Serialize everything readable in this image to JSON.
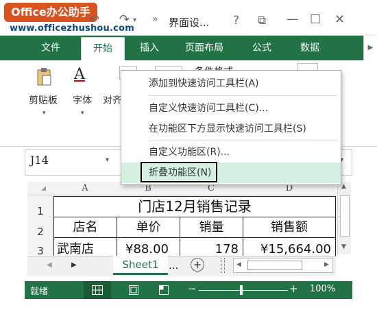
{
  "brand": {
    "logo_text": "Office办公助手",
    "watermark": "www.officezhushou.com"
  },
  "titlebar": {
    "title": "界面设...",
    "help": "?",
    "restore": "⧉",
    "minimize": "—",
    "maximize": "☐",
    "close": "✕"
  },
  "tabs": [
    {
      "label": "文件"
    },
    {
      "label": "开始"
    },
    {
      "label": "插入"
    },
    {
      "label": "页面布局"
    },
    {
      "label": "公式"
    },
    {
      "label": "数据"
    }
  ],
  "ribbon": {
    "clipboard_label": "剪贴板",
    "font_label": "字体",
    "align_label": "对齐",
    "conditional_format": "条件格式"
  },
  "context_menu": {
    "items": [
      {
        "label": "添加到快速访问工具栏(A)"
      },
      {
        "label": "自定义快速访问工具栏(C)..."
      },
      {
        "label": "在功能区下方显示快速访问工具栏(S)"
      },
      {
        "label": "自定义功能区(R)..."
      },
      {
        "label": "折叠功能区(N)"
      }
    ]
  },
  "formula_bar": {
    "name_box": "J14"
  },
  "columns": [
    "A",
    "B",
    "C",
    "D"
  ],
  "rows": [
    "1",
    "2",
    "3"
  ],
  "sheet": {
    "title": "门店12月销售记录",
    "headers": [
      "店名",
      "单价",
      "销量",
      "销售额"
    ],
    "row3": [
      "武南店",
      "¥88.00",
      "178",
      "¥15,664.00"
    ]
  },
  "sheet_tabs": {
    "active": "Sheet1",
    "more": "...",
    "add": "+"
  },
  "status": {
    "ready": "就绪",
    "zoom": "100%"
  },
  "colors": {
    "accent": "#217346",
    "brand": "#d9521f",
    "menu_highlight": "#d3f0e0"
  }
}
